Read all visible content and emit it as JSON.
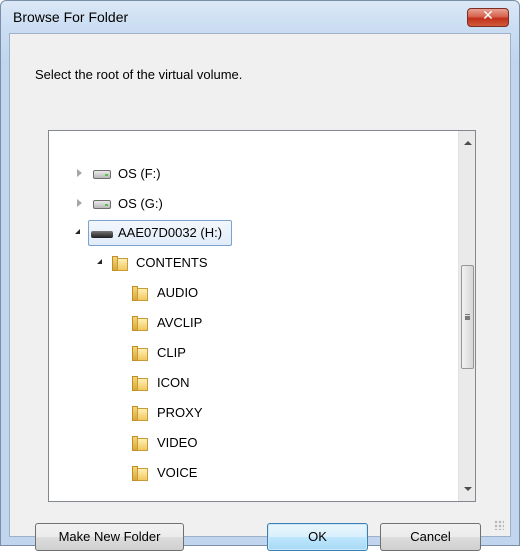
{
  "window": {
    "title": "Browse For Folder",
    "close_glyph": "✕"
  },
  "prompt": "Select the root of the virtual volume.",
  "tree": {
    "items": [
      {
        "label": "OS (F:)",
        "icon": "drive-icon",
        "expanded": false
      },
      {
        "label": "OS (G:)",
        "icon": "drive-icon",
        "expanded": false
      },
      {
        "label": "AAE07D0032 (H:)",
        "icon": "removable-drive-icon",
        "expanded": true,
        "selected": true
      },
      {
        "label": "CONTENTS",
        "icon": "folder-icon",
        "expanded": true
      },
      {
        "label": "AUDIO",
        "icon": "folder-icon"
      },
      {
        "label": "AVCLIP",
        "icon": "folder-icon"
      },
      {
        "label": "CLIP",
        "icon": "folder-icon"
      },
      {
        "label": "ICON",
        "icon": "folder-icon"
      },
      {
        "label": "PROXY",
        "icon": "folder-icon"
      },
      {
        "label": "VIDEO",
        "icon": "folder-icon"
      },
      {
        "label": "VOICE",
        "icon": "folder-icon"
      }
    ]
  },
  "buttons": {
    "make_new_folder": "Make New Folder",
    "ok": "OK",
    "cancel": "Cancel"
  },
  "colors": {
    "title_gradient_top": "#dbe8f6",
    "close_button": "#c1301a",
    "selection_border": "#7da2ce",
    "default_button_border": "#3c7fb1"
  }
}
